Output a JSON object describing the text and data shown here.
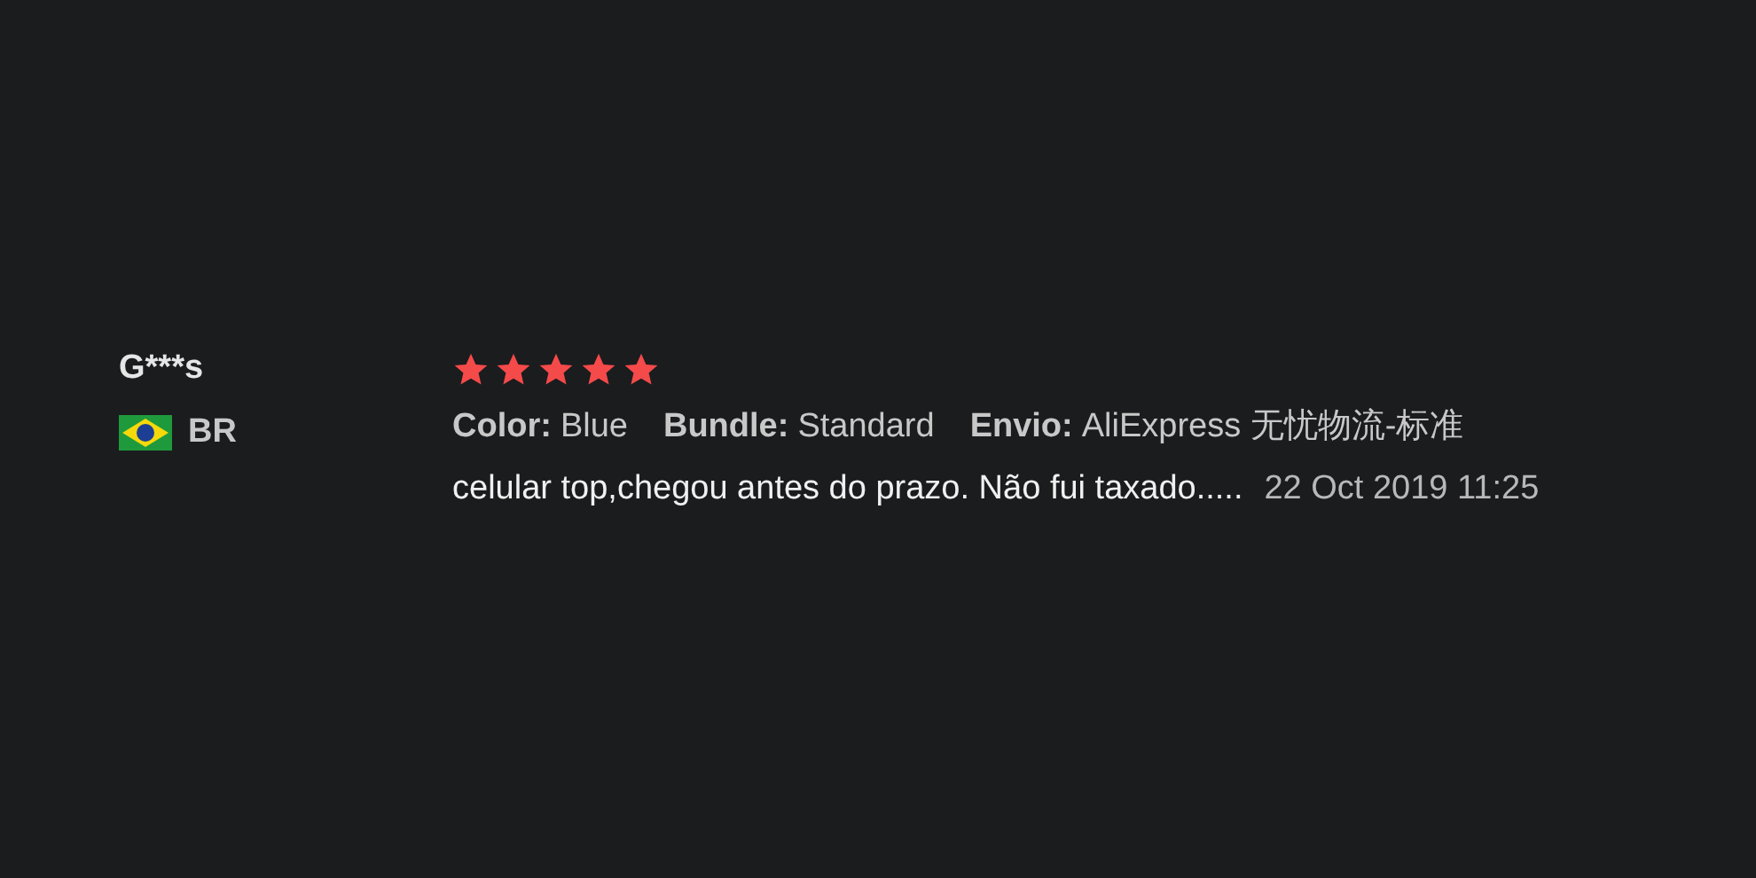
{
  "review": {
    "author": "G***s",
    "country": "BR",
    "stars": 5,
    "attributes": [
      {
        "label": "Color:",
        "value": "Blue"
      },
      {
        "label": "Bundle:",
        "value": "Standard"
      },
      {
        "label": "Envio:",
        "value": "AliExpress 无忧物流-标准"
      }
    ],
    "text": "celular top,chegou antes do prazo. Não fui taxado.....",
    "date": "22 Oct 2019 11:25"
  }
}
